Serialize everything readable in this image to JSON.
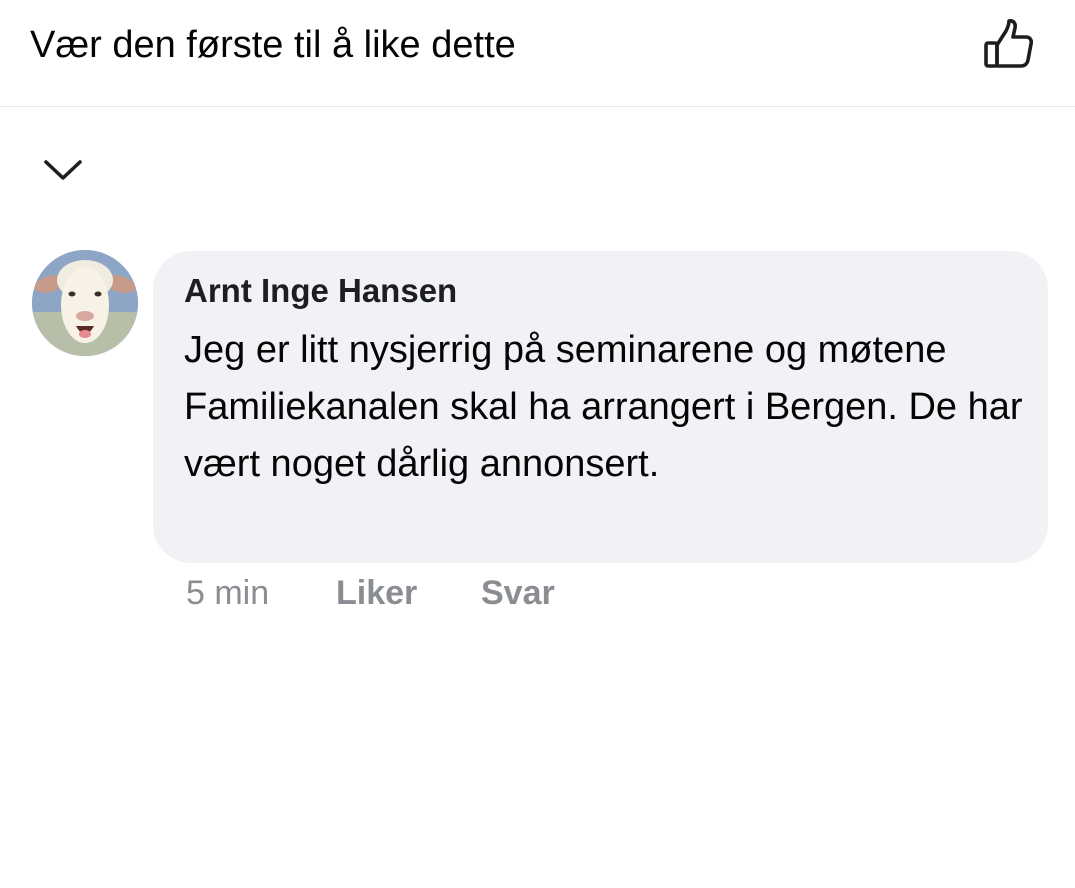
{
  "like_bar": {
    "text": "Vær den første til å like dette",
    "like_icon": "thumbs-up-outline-icon"
  },
  "collapse_icon": "chevron-down-icon",
  "comment": {
    "avatar_icon": "sheep-avatar",
    "author": "Arnt Inge Hansen",
    "text": "Jeg er litt nysjerrig på seminarene og møtene Familiekanalen skal ha arrangert i Bergen. De har vært noget dårlig annonsert.",
    "time": "5 min",
    "like_label": "Liker",
    "reply_label": "Svar"
  },
  "colors": {
    "bubble": "#f0f2f5",
    "meta_text": "#8a8d91",
    "primary_text": "#050505"
  }
}
